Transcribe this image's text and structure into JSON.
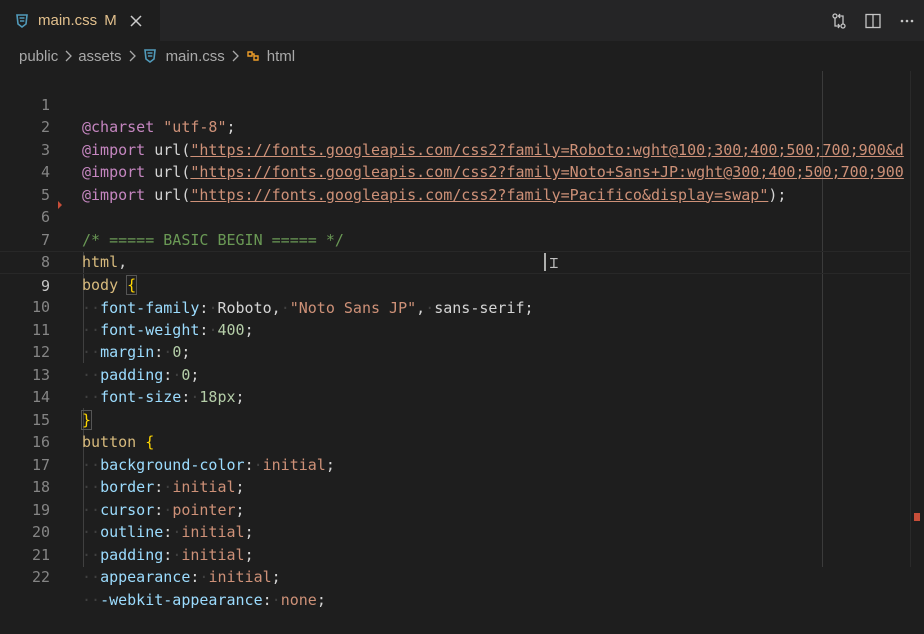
{
  "tab": {
    "filename": "main.css",
    "status": "M",
    "icon": "css-file-icon"
  },
  "toolbar": {
    "actions": [
      "source-control-compare-icon",
      "split-editor-icon"
    ]
  },
  "breadcrumb": {
    "items": [
      "public",
      "assets",
      "main.css",
      "html"
    ]
  },
  "lines": [
    {
      "n": "1"
    },
    {
      "n": "2"
    },
    {
      "n": "3"
    },
    {
      "n": "4"
    },
    {
      "n": "5"
    },
    {
      "n": "6"
    },
    {
      "n": "7"
    },
    {
      "n": "8"
    },
    {
      "n": "9"
    },
    {
      "n": "10"
    },
    {
      "n": "11"
    },
    {
      "n": "12"
    },
    {
      "n": "13"
    },
    {
      "n": "14"
    },
    {
      "n": "15"
    },
    {
      "n": "16"
    },
    {
      "n": "17"
    },
    {
      "n": "18"
    },
    {
      "n": "19"
    },
    {
      "n": "20"
    },
    {
      "n": "21"
    },
    {
      "n": "22"
    }
  ],
  "code": {
    "l1": {
      "at": "@charset",
      "val": "\"utf-8\"",
      "end": ";"
    },
    "l2": {
      "at": "@import",
      "fn": "url(",
      "url": "\"https://fonts.googleapis.com/css2?family=Roboto:wght@100;300;400;500;700;900&d"
    },
    "l3": {
      "at": "@import",
      "fn": "url(",
      "url": "\"https://fonts.googleapis.com/css2?family=Noto+Sans+JP:wght@300;400;500;700;900"
    },
    "l4": {
      "at": "@import",
      "fn": "url(",
      "url": "\"https://fonts.googleapis.com/css2?family=Pacifico&display=swap\"",
      "end": ");"
    },
    "l6": {
      "comment": "/* ===== BASIC BEGIN ===== */"
    },
    "l7": {
      "sel": "html",
      "end": ","
    },
    "l8": {
      "sel": "body",
      "brace": "{"
    },
    "l9": {
      "prop": "font-family",
      "v1": "Roboto",
      "v2": "\"Noto Sans JP\"",
      "v3": "sans-serif"
    },
    "l10": {
      "prop": "font-weight",
      "num": "400"
    },
    "l11": {
      "prop": "margin",
      "num": "0"
    },
    "l12": {
      "prop": "padding",
      "num": "0"
    },
    "l13": {
      "prop": "font-size",
      "num": "18px"
    },
    "l14": {
      "brace": "}"
    },
    "l15": {
      "sel": "button",
      "brace": "{"
    },
    "l16": {
      "prop": "background-color",
      "val": "initial"
    },
    "l17": {
      "prop": "border",
      "val": "initial"
    },
    "l18": {
      "prop": "cursor",
      "val": "pointer"
    },
    "l19": {
      "prop": "outline",
      "val": "initial"
    },
    "l20": {
      "prop": "padding",
      "val": "initial"
    },
    "l21": {
      "prop": "appearance",
      "val": "initial"
    },
    "l22": {
      "prop": "-webkit-appearance",
      "val": "none"
    }
  },
  "colors": {
    "accent_css": "#519aba",
    "modified": "#e2c08d",
    "symbol": "#ee9d28"
  }
}
